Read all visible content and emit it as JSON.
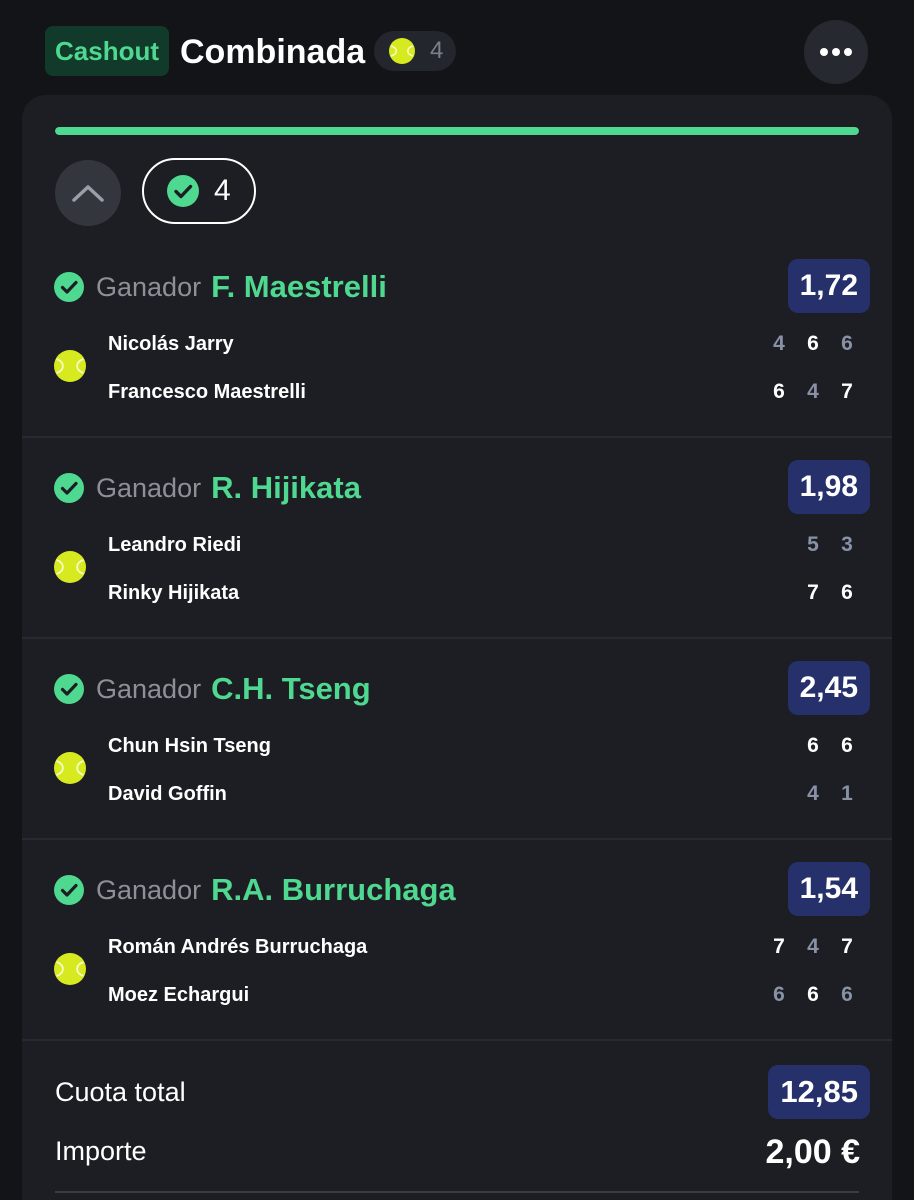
{
  "header": {
    "badge": "Cashout",
    "title": "Combinada",
    "legs_count": "4"
  },
  "progress": {
    "fraction": 1.0
  },
  "won_count": "4",
  "selections": [
    {
      "market": "Ganador",
      "pick": "F. Maestrelli",
      "odds": "1,72",
      "players": [
        {
          "name": "Nicolás Jarry",
          "sets": [
            {
              "v": "4",
              "won": false
            },
            {
              "v": "6",
              "won": true
            },
            {
              "v": "6",
              "won": false
            }
          ]
        },
        {
          "name": "Francesco Maestrelli",
          "sets": [
            {
              "v": "6",
              "won": true
            },
            {
              "v": "4",
              "won": false
            },
            {
              "v": "7",
              "won": true
            }
          ]
        }
      ]
    },
    {
      "market": "Ganador",
      "pick": "R. Hijikata",
      "odds": "1,98",
      "players": [
        {
          "name": "Leandro Riedi",
          "sets": [
            {
              "v": "5",
              "won": false
            },
            {
              "v": "3",
              "won": false
            }
          ]
        },
        {
          "name": "Rinky Hijikata",
          "sets": [
            {
              "v": "7",
              "won": true
            },
            {
              "v": "6",
              "won": true
            }
          ]
        }
      ]
    },
    {
      "market": "Ganador",
      "pick": "C.H. Tseng",
      "odds": "2,45",
      "players": [
        {
          "name": "Chun Hsin Tseng",
          "sets": [
            {
              "v": "6",
              "won": true
            },
            {
              "v": "6",
              "won": true
            }
          ]
        },
        {
          "name": "David Goffin",
          "sets": [
            {
              "v": "4",
              "won": false
            },
            {
              "v": "1",
              "won": false
            }
          ]
        }
      ]
    },
    {
      "market": "Ganador",
      "pick": "R.A. Burruchaga",
      "odds": "1,54",
      "players": [
        {
          "name": "Román Andrés Burruchaga",
          "sets": [
            {
              "v": "7",
              "won": true
            },
            {
              "v": "4",
              "won": false
            },
            {
              "v": "7",
              "won": true
            }
          ]
        },
        {
          "name": "Moez Echargui",
          "sets": [
            {
              "v": "6",
              "won": false
            },
            {
              "v": "6",
              "won": true
            },
            {
              "v": "6",
              "won": false
            }
          ]
        }
      ]
    }
  ],
  "summary": {
    "total_odds_label": "Cuota total",
    "total_odds": "12,85",
    "stake_label": "Importe",
    "stake": "2,00 €"
  },
  "colors": {
    "accent": "#4fd88f",
    "odds_bg": "#26306a",
    "card_bg": "#1c1e23",
    "page_bg": "#121418"
  },
  "icons": {
    "sport": "tennis-ball-icon",
    "won": "check-circle-icon",
    "collapse": "chevron-up-icon",
    "more": "more-dots-icon"
  }
}
